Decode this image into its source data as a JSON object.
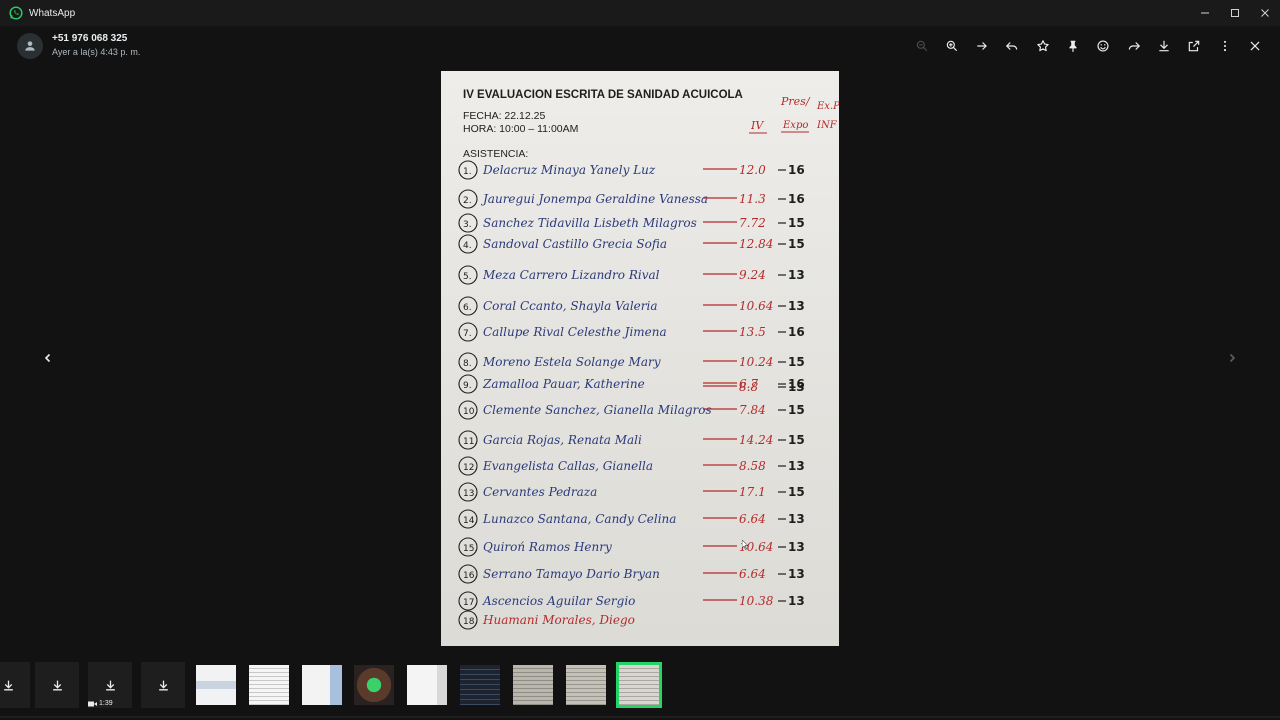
{
  "app": {
    "title": "WhatsApp",
    "accent": "#25d366"
  },
  "window_controls": [
    "minimize-icon",
    "maximize-icon",
    "close-icon"
  ],
  "viewer": {
    "sender": "+51 976 068 325",
    "timestamp": "Ayer a la(s) 4:43 p. m.",
    "toolbar_icons": [
      "zoom-out-icon",
      "zoom-in-icon",
      "go-to-message-icon",
      "reply-icon",
      "star-icon",
      "pin-icon",
      "react-emoji-icon",
      "forward-icon",
      "download-icon",
      "open-external-icon",
      "more-options-icon",
      "close-icon"
    ]
  },
  "document": {
    "title": "IV EVALUACION ESCRITA DE SANIDAD ACUICOLA",
    "fecha": "FECHA: 22.12.25",
    "hora": "HORA: 10:00 – 11:00AM",
    "asistencia": "ASISTENCIA:",
    "col_head_1": "Pres/",
    "col_head_2": "Ex.P",
    "col_iv": "IV",
    "col_expo": "Expo",
    "col_inf": "INF",
    "students": [
      {
        "n": "1.",
        "name": "Delacruz Minaya Yanely Luz",
        "score": "12.0",
        "grade": "16"
      },
      {
        "n": "2.",
        "name": "Jauregui Jonempa Geraldine Vanessa",
        "score": "11.3",
        "grade": "16"
      },
      {
        "n": "3.",
        "name": "Sanchez Tidavilla Lisbeth Milagros",
        "score": "7.72",
        "grade": "15"
      },
      {
        "n": "4.",
        "name": "Sandoval Castillo Grecia Sofia",
        "score": "12.84",
        "grade": "15"
      },
      {
        "n": "5.",
        "name": "Meza Carrero Lizandro Rival",
        "score": "9.24",
        "grade": "13"
      },
      {
        "n": "6.",
        "name": "Coral Ccanto, Shayla Valeria",
        "score": "10.64",
        "grade": "13"
      },
      {
        "n": "7.",
        "name": "Callupe Rival Celesthe Jimena",
        "score": "13.5",
        "grade": "16"
      },
      {
        "n": "8.",
        "name": "Moreno Estela Solange Mary",
        "score": "10.24",
        "grade": "15"
      },
      {
        "n": "9.",
        "name": "Zamalloa Pauar, Katherine",
        "score": "6.7",
        "grade": "16"
      },
      {
        "n": "",
        "name": "",
        "score": "8.8",
        "grade": "13"
      },
      {
        "n": "10.",
        "name": "Clemente Sanchez, Gianella Milagros",
        "score": "7.84",
        "grade": "15"
      },
      {
        "n": "11.",
        "name": "Garcia Rojas, Renata Mali",
        "score": "14.24",
        "grade": "15"
      },
      {
        "n": "12.",
        "name": "Evangelista Callas, Gianella",
        "score": "8.58",
        "grade": "13"
      },
      {
        "n": "13.",
        "name": "Cervantes Pedraza",
        "score": "17.1",
        "grade": "15"
      },
      {
        "n": "14.",
        "name": "Lunazco Santana, Candy Celina",
        "score": "6.64",
        "grade": "13"
      },
      {
        "n": "15.",
        "name": "Quiroń Ramos Henry",
        "score": "10.64",
        "grade": "13"
      },
      {
        "n": "16.",
        "name": "Serrano Tamayo Dario Bryan",
        "score": "6.64",
        "grade": "13"
      },
      {
        "n": "17.",
        "name": "Ascencios Aguilar Sergio",
        "score": "10.38",
        "grade": "13"
      },
      {
        "n": "18.",
        "name": "Huamani Morales, Diego",
        "score": "",
        "grade": ""
      }
    ]
  },
  "strip": {
    "video_duration": "1:39",
    "thumbnails": [
      "download",
      "download",
      "download",
      "download",
      "document",
      "document",
      "document",
      "photo-green",
      "document",
      "dark-screen",
      "paper",
      "paper",
      "paper-selected"
    ]
  }
}
